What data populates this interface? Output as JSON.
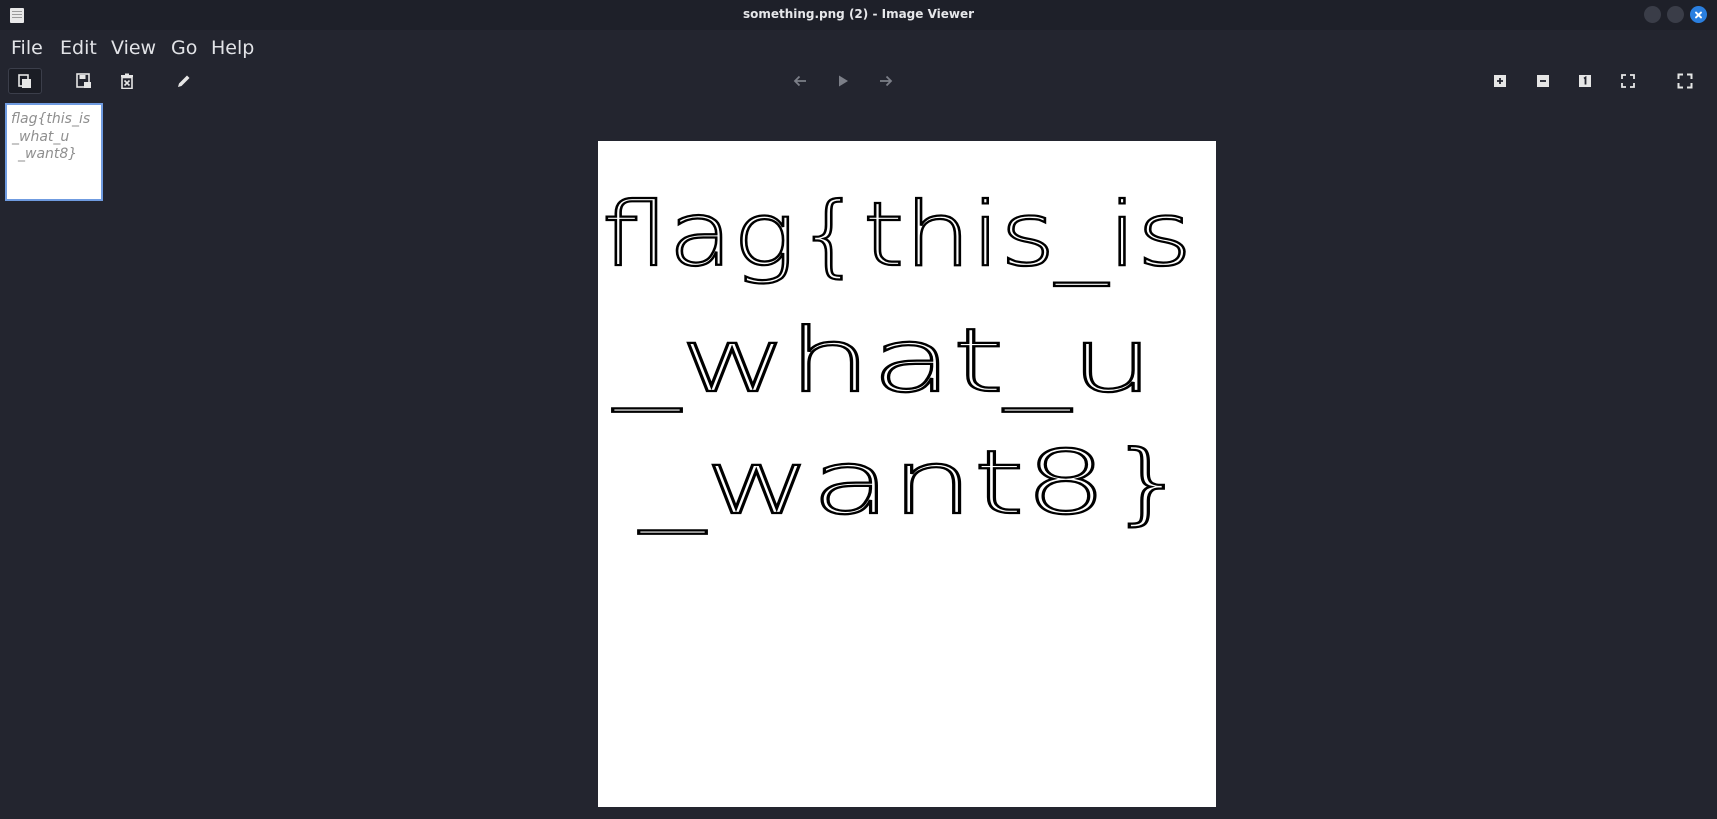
{
  "window": {
    "title": "something.png (2) - Image Viewer"
  },
  "menu": {
    "items": [
      "File",
      "Edit",
      "View",
      "Go",
      "Help"
    ]
  },
  "toolbar": {
    "left_icons": [
      "open-icon",
      "save-icon",
      "delete-icon",
      "edit-icon"
    ],
    "center_icons": [
      "previous-icon",
      "play-icon",
      "next-icon"
    ],
    "right_icons": [
      "zoom-in-icon",
      "zoom-out-icon",
      "zoom-100-icon",
      "zoom-fit-icon",
      "fullscreen-icon"
    ]
  },
  "image": {
    "lines": [
      "flag{this_is",
      "_what_u",
      "_want8}"
    ],
    "background": "#ffffff",
    "ink": "#000000"
  },
  "thumbnail": {
    "lines": [
      "flag{this_is",
      "_what_u",
      "_want8}"
    ]
  },
  "colors": {
    "background": "#23252f",
    "accent": "#2a7fe0",
    "selection_border": "#6f9be0"
  }
}
